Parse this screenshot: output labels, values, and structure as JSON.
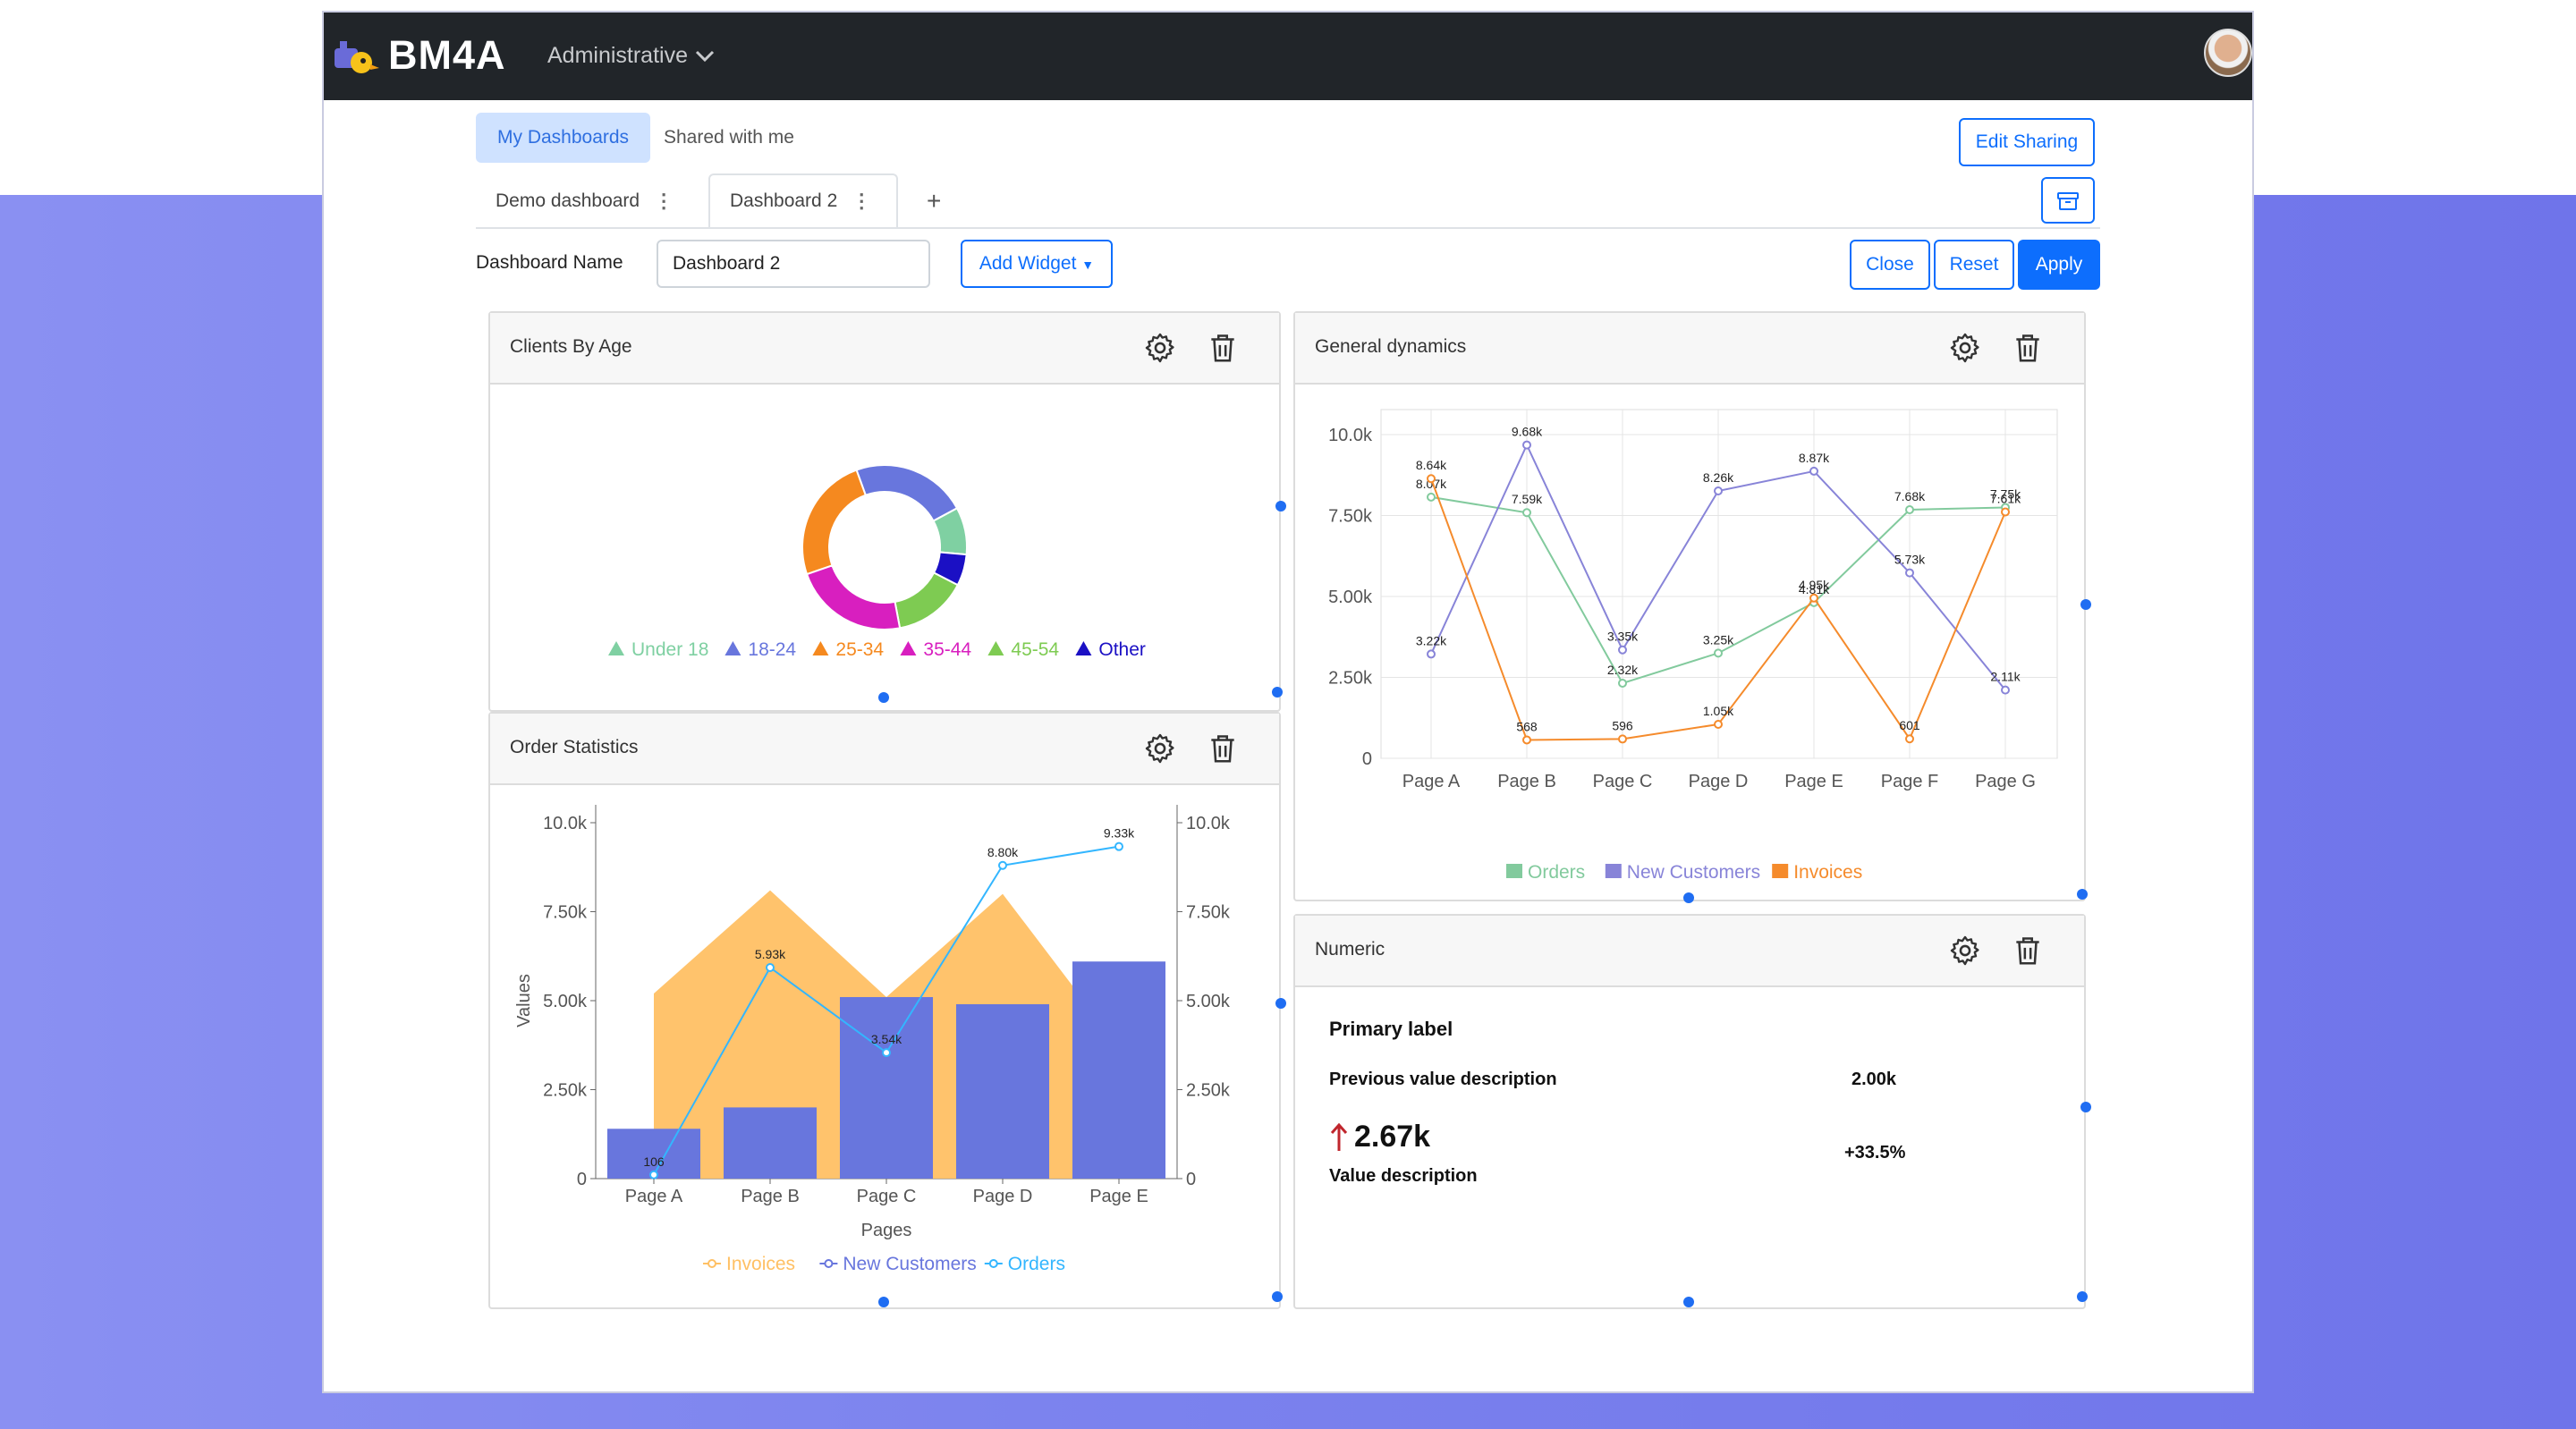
{
  "app": {
    "brand": "BM4A",
    "menu_label": "Administrative"
  },
  "tabs": {
    "my_dashboards": "My Dashboards",
    "shared_with_me": "Shared with me",
    "edit_sharing": "Edit Sharing",
    "dashboards": [
      {
        "label": "Demo dashboard",
        "active": false
      },
      {
        "label": "Dashboard 2",
        "active": true
      }
    ],
    "add_tab": "+"
  },
  "toolbar": {
    "name_label": "Dashboard Name",
    "name_value": "Dashboard 2",
    "add_widget": "Add Widget",
    "close": "Close",
    "reset": "Reset",
    "apply": "Apply"
  },
  "widgets": {
    "clients_by_age": {
      "title": "Clients By Age",
      "chart_data": {
        "type": "pie",
        "categories": [
          "Under 18",
          "18-24",
          "25-34",
          "35-44",
          "45-54",
          "Other"
        ],
        "values": [
          9,
          22,
          24,
          22,
          14,
          6
        ],
        "colors": [
          "#7fd0a2",
          "#6876dd",
          "#f5891f",
          "#d81fbf",
          "#7ecb52",
          "#1b10c4"
        ]
      }
    },
    "general_dynamics": {
      "title": "General dynamics",
      "chart_data": {
        "type": "line",
        "x": [
          "Page A",
          "Page B",
          "Page C",
          "Page D",
          "Page E",
          "Page F",
          "Page G"
        ],
        "yticks": [
          "0",
          "2.50k",
          "5.00k",
          "7.50k",
          "10.0k"
        ],
        "ylim": [
          0,
          10500
        ],
        "series": [
          {
            "name": "Orders",
            "color": "#82ca9d",
            "values": [
              8070,
              7590,
              2320,
              3250,
              4810,
              7680,
              7750
            ],
            "labels": [
              "8.07k",
              "7.59k",
              "2.32k",
              "3.25k",
              "4.81k",
              "7.68k",
              "7.75k"
            ]
          },
          {
            "name": "New Customers",
            "color": "#8884d8",
            "values": [
              3220,
              9680,
              3350,
              8260,
              8870,
              5730,
              2110
            ],
            "labels": [
              "3.22k",
              "9.68k",
              "3.35k",
              "8.26k",
              "8.87k",
              "5.73k",
              "2.11k"
            ]
          },
          {
            "name": "Invoices",
            "color": "#f58b2c",
            "values": [
              8640,
              568,
              596,
              1050,
              4950,
              601,
              7610
            ],
            "labels": [
              "8.64k",
              "568",
              "596",
              "1.05k",
              "4.95k",
              "601",
              "7.61k"
            ]
          }
        ]
      }
    },
    "order_statistics": {
      "title": "Order Statistics",
      "chart_data": {
        "type": "bar",
        "categories": [
          "Page A",
          "Page B",
          "Page C",
          "Page D",
          "Page E"
        ],
        "xlabel": "Pages",
        "ylabel": "Values",
        "yticks": [
          "0",
          "2.50k",
          "5.00k",
          "7.50k",
          "10.0k"
        ],
        "ylim": [
          0,
          10000
        ],
        "series": [
          {
            "name": "Invoices",
            "type": "area",
            "color": "#ffc064",
            "values": [
              5200,
              8100,
              5100,
              8000,
              3700
            ]
          },
          {
            "name": "New Customers",
            "type": "bar",
            "color": "#6876dd",
            "values": [
              1400,
              2000,
              5100,
              4900,
              6100
            ]
          },
          {
            "name": "Orders",
            "type": "line",
            "color": "#33b6ff",
            "values": [
              106,
              5930,
              3540,
              8800,
              9330
            ],
            "labels": [
              "106",
              "5.93k",
              "3.54k",
              "8.80k",
              "9.33k"
            ]
          }
        ]
      }
    },
    "numeric": {
      "title": "Numeric",
      "primary_label": "Primary label",
      "previous_desc": "Previous value description",
      "previous_value": "2.00k",
      "value": "2.67k",
      "change": "+33.5%",
      "value_desc": "Value description"
    }
  }
}
